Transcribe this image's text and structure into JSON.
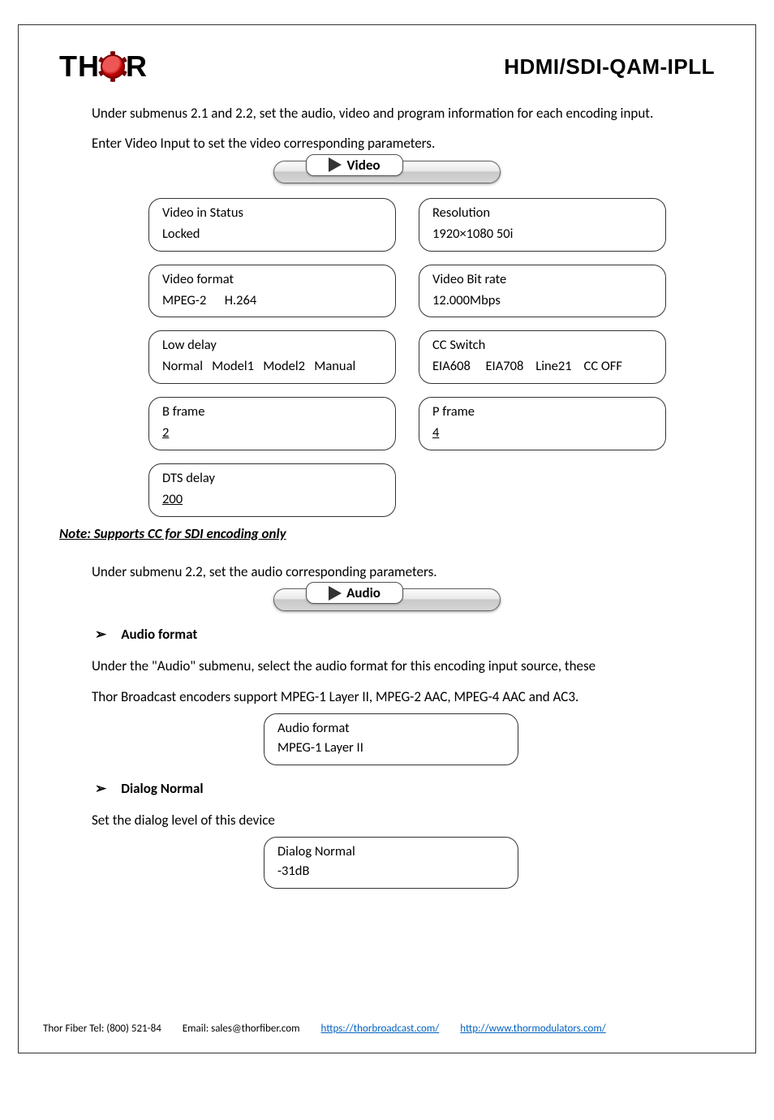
{
  "header": {
    "logo_left": "TH",
    "logo_right": "R",
    "doc_title": "HDMI/SDI-QAM-IPLL"
  },
  "intro": {
    "p1": "Under submenus 2.1 and 2.2, set the audio, video and program information for each encoding input.",
    "p2": "Enter Video Input to set the video corresponding parameters."
  },
  "video": {
    "menu_label": "Video",
    "boxes": {
      "video_in_status": {
        "title": "Video in Status",
        "value": "Locked"
      },
      "resolution": {
        "title": "Resolution",
        "value": "1920×1080 50i"
      },
      "video_format": {
        "title": "Video format",
        "value": "MPEG-2      H.264"
      },
      "video_bitrate": {
        "title": "Video Bit rate",
        "value": "12.000Mbps"
      },
      "low_delay": {
        "title": "Low delay",
        "value": "Normal   Model1   Model2   Manual"
      },
      "cc_switch": {
        "title": "CC Switch",
        "value": "EIA608     EIA708    Line21    CC OFF"
      },
      "b_frame": {
        "title": "B frame",
        "value": "2"
      },
      "p_frame": {
        "title": "P frame",
        "value": "4"
      },
      "dts_delay": {
        "title": "DTS delay",
        "value": "200"
      }
    }
  },
  "note": "Note: Supports CC for SDI encoding only",
  "audio_intro": "Under submenu 2.2, set the audio corresponding parameters.",
  "audio": {
    "menu_label": "Audio",
    "format_heading": "Audio format",
    "format_desc_1": "Under the \"Audio\" submenu, select the audio format for this encoding input source, these",
    "format_desc_2": "Thor Broadcast encoders support MPEG-1 Layer II, MPEG-2 AAC, MPEG-4 AAC and AC3.",
    "format_box": {
      "title": "Audio format",
      "value": "MPEG-1 Layer II"
    },
    "dialog_heading": "Dialog Normal",
    "dialog_desc": "Set the dialog level of this device",
    "dialog_box": {
      "title": "Dialog Normal",
      "value": "-31dB"
    }
  },
  "footer": {
    "tel": "Thor Fiber Tel: (800) 521-84",
    "email": "Email: sales@thorfiber.com",
    "link1": "https://thorbroadcast.com/",
    "link2": "http://www.thormodulators.com/"
  }
}
